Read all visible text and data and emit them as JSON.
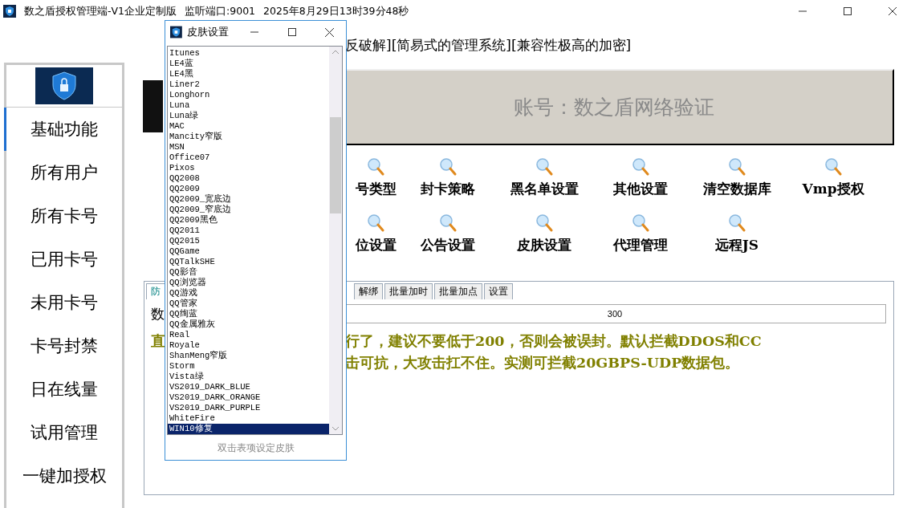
{
  "window": {
    "title": "数之盾授权管理端-V1企业定制版",
    "port": "监听端口:9001",
    "datetime": "2025年8月29日13时39分48秒"
  },
  "sidebar": {
    "items": [
      {
        "label": "基础功能",
        "selected": true
      },
      {
        "label": "所有用户",
        "selected": false
      },
      {
        "label": "所有卡号",
        "selected": false
      },
      {
        "label": "已用卡号",
        "selected": false
      },
      {
        "label": "未用卡号",
        "selected": false
      },
      {
        "label": "卡号封禁",
        "selected": false
      },
      {
        "label": "日在线量",
        "selected": false
      },
      {
        "label": "试用管理",
        "selected": false
      },
      {
        "label": "一键加授权",
        "selected": false
      }
    ]
  },
  "headline": "反破解][简易式的管理系统][兼容性极高的加密]",
  "account_button": "账号：数之盾网络验证",
  "function_rows": [
    [
      "号类型",
      "封卡策略",
      "黑名单设置",
      "其他设置",
      "清空数据库",
      "Vmp授权"
    ],
    [
      "位设置",
      "公告设置",
      "皮肤设置",
      "代理管理",
      "远程JS"
    ]
  ],
  "tabs": [
    {
      "label": "防",
      "selected": true
    },
    {
      "label": "解绑",
      "selected": false
    },
    {
      "label": "批量加时",
      "selected": false
    },
    {
      "label": "批量加点",
      "selected": false
    },
    {
      "label": "设置",
      "selected": false
    }
  ],
  "setting": {
    "label": "数",
    "value": "300"
  },
  "notes": [
    {
      "lead": "直",
      "text": "行了，建议不要低于200，否则会被误封。默认拦截DDOS和CC"
    },
    {
      "text": "击可抗，大攻击扛不住。实测可拦截20GBPS-UDP数据包。"
    }
  ],
  "skin_dialog": {
    "title": "皮肤设置",
    "hint": "双击表项设定皮肤",
    "items": [
      {
        "label": "Itunes",
        "selected": false
      },
      {
        "label": "LE4蓝",
        "selected": false
      },
      {
        "label": "LE4黑",
        "selected": false
      },
      {
        "label": "Liner2",
        "selected": false
      },
      {
        "label": "Longhorn",
        "selected": false
      },
      {
        "label": "Luna",
        "selected": false
      },
      {
        "label": "Luna绿",
        "selected": false
      },
      {
        "label": "MAC",
        "selected": false
      },
      {
        "label": "Mancity窄版",
        "selected": false
      },
      {
        "label": "MSN",
        "selected": false
      },
      {
        "label": "Office07",
        "selected": false
      },
      {
        "label": "Pixos",
        "selected": false
      },
      {
        "label": "QQ2008",
        "selected": false
      },
      {
        "label": "QQ2009",
        "selected": false
      },
      {
        "label": "QQ2009_宽底边",
        "selected": false
      },
      {
        "label": "QQ2009_窄底边",
        "selected": false
      },
      {
        "label": "QQ2009黑色",
        "selected": false
      },
      {
        "label": "QQ2011",
        "selected": false
      },
      {
        "label": "QQ2015",
        "selected": false
      },
      {
        "label": "QQGame",
        "selected": false
      },
      {
        "label": "QQTalkSHE",
        "selected": false
      },
      {
        "label": "QQ影音",
        "selected": false
      },
      {
        "label": "QQ浏览器",
        "selected": false
      },
      {
        "label": "QQ游戏",
        "selected": false
      },
      {
        "label": "QQ管家",
        "selected": false
      },
      {
        "label": "QQ绚蓝",
        "selected": false
      },
      {
        "label": "QQ金属雅灰",
        "selected": false
      },
      {
        "label": "Real",
        "selected": false
      },
      {
        "label": "Royale",
        "selected": false
      },
      {
        "label": "ShanMeng窄版",
        "selected": false
      },
      {
        "label": "Storm",
        "selected": false
      },
      {
        "label": "Vista绿",
        "selected": false
      },
      {
        "label": "VS2019_DARK_BLUE",
        "selected": false
      },
      {
        "label": "VS2019_DARK_ORANGE",
        "selected": false
      },
      {
        "label": "VS2019_DARK_PURPLE",
        "selected": false
      },
      {
        "label": "WhiteFire",
        "selected": false
      },
      {
        "label": "WIN10修复",
        "selected": true
      }
    ]
  }
}
